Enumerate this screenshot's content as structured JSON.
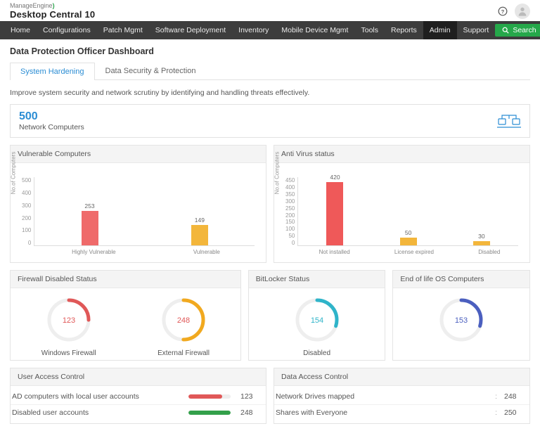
{
  "brand": {
    "manageengine": "ManageEngine",
    "product": "Desktop Central 10"
  },
  "nav": {
    "items": [
      "Home",
      "Configurations",
      "Patch Mgmt",
      "Software Deployment",
      "Inventory",
      "Mobile Device Mgmt",
      "Tools",
      "Reports",
      "Admin",
      "Support"
    ],
    "active_index": 8,
    "search_label": "Search"
  },
  "page": {
    "title": "Data Protection Officer Dashboard",
    "tabs": [
      "System Hardening",
      "Data Security & Protection"
    ],
    "active_tab": 0,
    "description": "Improve system security and network scrutiny by identifying and handling threats effectively.",
    "summary": {
      "value": "500",
      "label": "Network Computers"
    }
  },
  "panels": {
    "vuln": {
      "title": "Vulnerable Computers"
    },
    "av": {
      "title": "Anti Virus status"
    },
    "fw": {
      "title": "Firewall Disabled Status",
      "dials": [
        {
          "label": "Windows Firewall",
          "value": "123",
          "color": "#e05858",
          "frac": 0.25
        },
        {
          "label": "External Firewall",
          "value": "248",
          "color": "#f1a91f",
          "frac": 0.5
        }
      ]
    },
    "bl": {
      "title": "BitLocker Status",
      "dials": [
        {
          "label": "Disabled",
          "value": "154",
          "color": "#2fb4c9",
          "frac": 0.3,
          "valcolor": "#2fb4c9"
        }
      ]
    },
    "eol": {
      "title": "End of life OS Computers",
      "dials": [
        {
          "label": "",
          "value": "153",
          "color": "#4b5fbf",
          "frac": 0.3,
          "valcolor": "#4b5fbf"
        }
      ]
    },
    "uac": {
      "title": "User Access Control",
      "rows": [
        {
          "label": "AD computers with local  user accounts",
          "value": "123",
          "color": "#e05858",
          "w": 48
        },
        {
          "label": "Disabled user accounts",
          "value": "248",
          "color": "#33a04a",
          "w": 60
        }
      ]
    },
    "dac": {
      "title": "Data Access Control",
      "rows": [
        {
          "label": "Network Drives mapped",
          "value": "248"
        },
        {
          "label": "Shares with Everyone",
          "value": "250"
        }
      ]
    }
  },
  "chart_data": [
    {
      "id": "vuln",
      "type": "bar",
      "title": "Vulnerable Computers",
      "ylabel": "No.of Computers",
      "ylim": [
        0,
        500
      ],
      "yticks": [
        0,
        100,
        200,
        300,
        400,
        500
      ],
      "categories": [
        "Highly Vulnerable",
        "Vulnerable"
      ],
      "values": [
        253,
        149
      ],
      "colors": [
        "#ef6a6a",
        "#f3b63b"
      ]
    },
    {
      "id": "av",
      "type": "bar",
      "title": "Anti Virus status",
      "ylabel": "No.of Computers",
      "ylim": [
        0,
        450
      ],
      "yticks": [
        0,
        50,
        100,
        150,
        200,
        250,
        300,
        350,
        400,
        450
      ],
      "categories": [
        "Not installed",
        "License expired",
        "Disabled"
      ],
      "values": [
        420,
        50,
        30
      ],
      "colors": [
        "#ef5959",
        "#f3b63b",
        "#f3b63b"
      ]
    }
  ]
}
